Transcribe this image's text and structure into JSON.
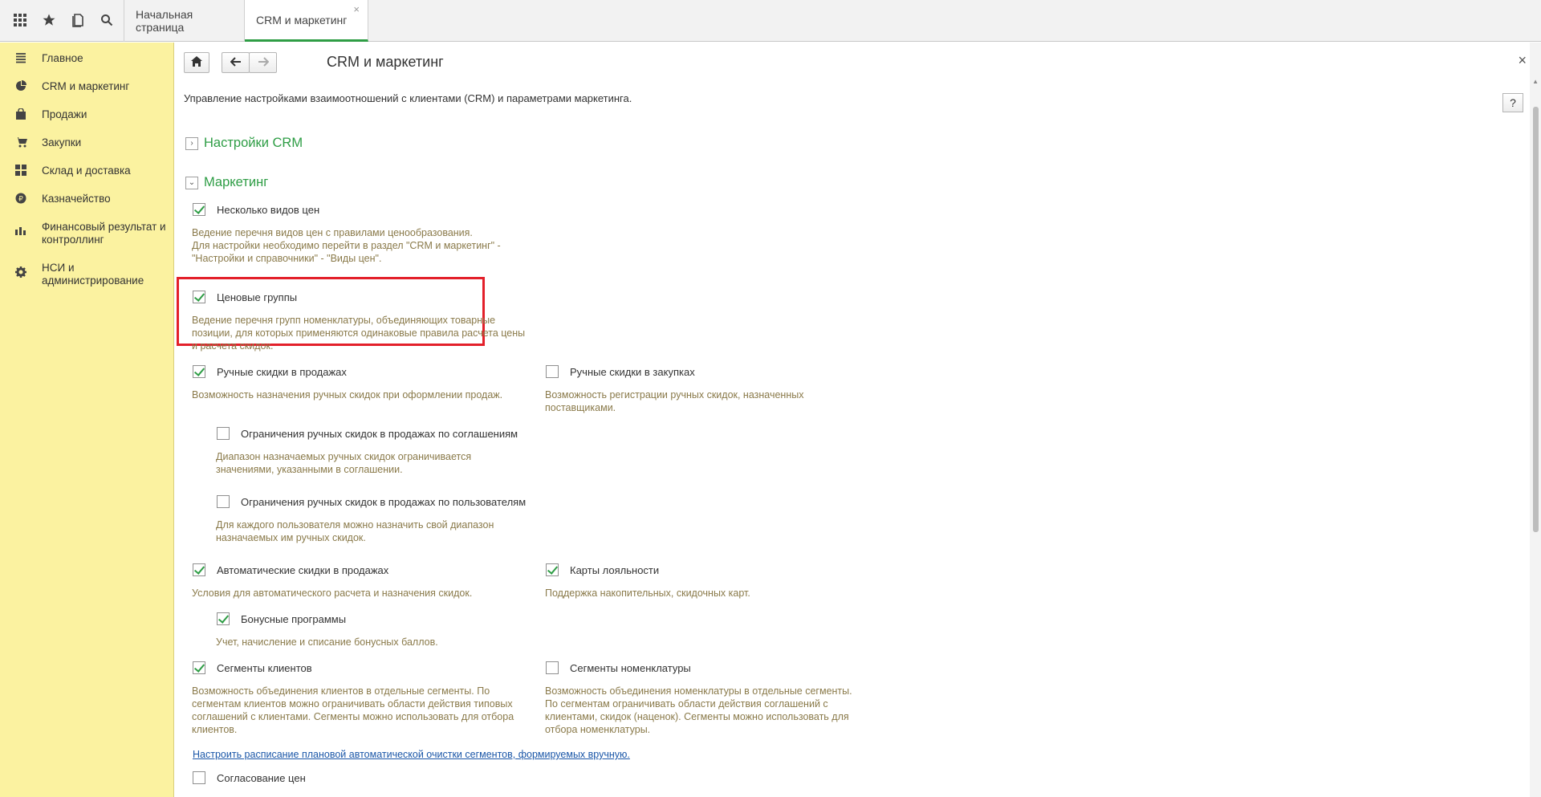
{
  "tabs": [
    {
      "label": "Начальная страница"
    },
    {
      "label": "CRM и маркетинг",
      "close": "×"
    }
  ],
  "sidebar": {
    "items": [
      {
        "label": "Главное",
        "icon": "menu-lines-icon"
      },
      {
        "label": "CRM и маркетинг",
        "icon": "pie-chart-icon"
      },
      {
        "label": "Продажи",
        "icon": "shopping-bag-icon"
      },
      {
        "label": "Закупки",
        "icon": "cart-icon"
      },
      {
        "label": "Склад и доставка",
        "icon": "warehouse-grid-icon"
      },
      {
        "label": "Казначейство",
        "icon": "ruble-coin-icon"
      },
      {
        "label": "Финансовый результат и\nконтроллинг",
        "icon": "bar-chart-icon"
      },
      {
        "label": "НСИ и\nадминистрирование",
        "icon": "gear-icon"
      }
    ]
  },
  "page": {
    "title": "CRM и маркетинг",
    "description": "Управление настройками взаимоотношений с клиентами (CRM) и параметрами маркетинга.",
    "help": "?",
    "close": "×"
  },
  "groups": {
    "crm": {
      "label": "Настройки CRM",
      "toggle": "›"
    },
    "marketing": {
      "label": "Маркетинг",
      "toggle": "⌄"
    }
  },
  "options": {
    "price_types": {
      "label": "Несколько видов цен",
      "checked": true,
      "hint": "Ведение перечня видов цен с правилами ценообразования.\nДля настройки необходимо перейти в раздел \"CRM и маркетинг\" -\n\"Настройки и справочники\" - \"Виды цен\"."
    },
    "price_groups": {
      "label": "Ценовые группы",
      "checked": true,
      "hint": "Ведение перечня групп номенклатуры, объединяющих товарные\nпозиции, для которых применяются одинаковые правила расчета цены\nи расчета скидок."
    },
    "manual_sales": {
      "label": "Ручные скидки в продажах",
      "checked": true,
      "hint": "Возможность назначения ручных скидок при оформлении продаж."
    },
    "manual_purchases": {
      "label": "Ручные скидки в закупках",
      "checked": false,
      "hint": "Возможность регистрации ручных скидок, назначенных\nпоставщиками."
    },
    "limit_agreements": {
      "label": "Ограничения ручных скидок в продажах по соглашениям",
      "checked": false,
      "hint": "Диапазон назначаемых ручных скидок ограничивается\nзначениями, указанными в соглашении."
    },
    "limit_users": {
      "label": "Ограничения ручных скидок в продажах по пользователям",
      "checked": false,
      "hint": "Для каждого пользователя можно назначить свой диапазон\nназначаемых им ручных скидок."
    },
    "auto_sales": {
      "label": "Автоматические скидки в продажах",
      "checked": true,
      "hint": "Условия для автоматического расчета и назначения скидок."
    },
    "loyalty_cards": {
      "label": "Карты лояльности",
      "checked": true,
      "hint": "Поддержка накопительных, скидочных карт."
    },
    "bonus": {
      "label": "Бонусные программы",
      "checked": true,
      "hint": "Учет, начисление и списание бонусных баллов."
    },
    "client_segments": {
      "label": "Сегменты клиентов",
      "checked": true,
      "hint": "Возможность объединения клиентов в отдельные сегменты. По\nсегментам клиентов можно ограничивать области действия типовых\nсоглашений с клиентами. Сегменты можно использовать для отбора\nклиентов."
    },
    "item_segments": {
      "label": "Сегменты номенклатуры",
      "checked": false,
      "hint": "Возможность объединения номенклатуры в отдельные сегменты.\nПо сегментам ограничивать области действия соглашений с\nклиентами, скидок (наценок). Сегменты можно использовать для\nотбора номенклатуры."
    },
    "price_approval": {
      "label": "Согласование цен",
      "checked": false
    }
  },
  "schedule_link": "Настроить расписание плановой автоматической очистки сегментов, формируемых вручную."
}
